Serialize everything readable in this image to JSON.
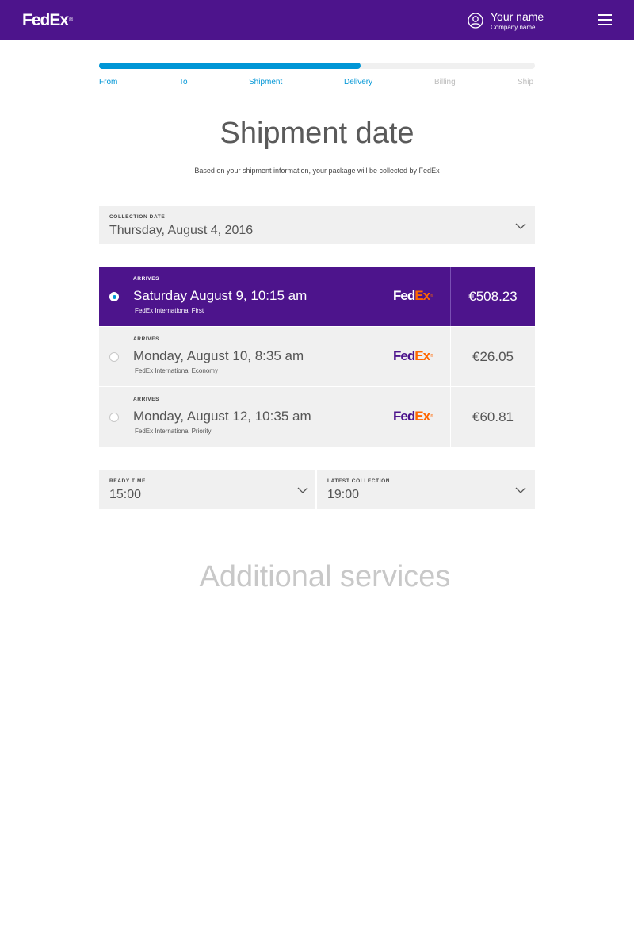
{
  "header": {
    "logo_fed": "Fed",
    "logo_ex": "Ex",
    "logo_reg": "®",
    "user_name": "Your name",
    "company_name": "Company name",
    "brand_color": "#4d148c"
  },
  "progress": {
    "completed_fraction": 0.6,
    "accent_color": "#0096d6",
    "steps": [
      {
        "label": "From",
        "state": "done"
      },
      {
        "label": "To",
        "state": "done"
      },
      {
        "label": "Shipment",
        "state": "done"
      },
      {
        "label": "Delivery",
        "state": "done"
      },
      {
        "label": "Billing",
        "state": "todo"
      },
      {
        "label": "Ship",
        "state": "todo"
      }
    ]
  },
  "page": {
    "title": "Shipment date",
    "subtitle": "Based on your shipment information, your package will be collected by FedEx"
  },
  "collection_date": {
    "label": "COLLECTION DATE",
    "value": "Thursday, August 4, 2016"
  },
  "options": [
    {
      "arrives_label": "ARRIVES",
      "date": "Saturday August 9, 10:15 am",
      "service": "FedEx International First",
      "price": "€508.23",
      "selected": true
    },
    {
      "arrives_label": "ARRIVES",
      "date": "Monday, August 10, 8:35 am",
      "service": "FedEx International Economy",
      "price": "€26.05",
      "selected": false
    },
    {
      "arrives_label": "ARRIVES",
      "date": "Monday, August 12, 10:35 am",
      "service": "FedEx International Priority",
      "price": "€60.81",
      "selected": false
    }
  ],
  "ready_time": {
    "label": "READY TIME",
    "value": "15:00"
  },
  "latest_collection": {
    "label": "LATEST COLLECTION",
    "value": "19:00"
  },
  "additional_services": {
    "title": "Additional services"
  }
}
